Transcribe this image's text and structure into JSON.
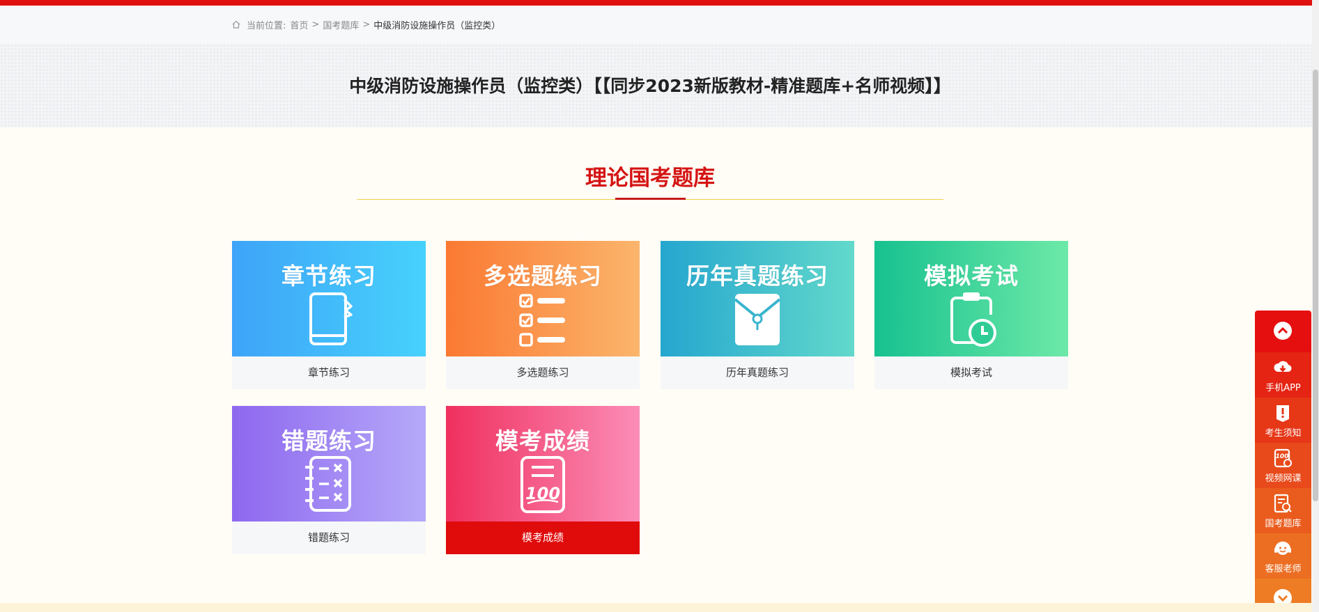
{
  "breadcrumb": {
    "prefix": "当前位置:",
    "items": [
      "首页",
      "国考题库",
      "中级消防设施操作员（监控类）"
    ],
    "separator": ">"
  },
  "page_title": "中级消防设施操作员（监控类）【【同步2023新版教材-精准题库+名师视频】】",
  "section_title": "理论国考题库",
  "cards": [
    {
      "banner": "章节练习",
      "caption": "章节练习",
      "icon": "book-icon"
    },
    {
      "banner": "多选题练习",
      "caption": "多选题练习",
      "icon": "checklist-icon"
    },
    {
      "banner": "历年真题练习",
      "caption": "历年真题练习",
      "icon": "file-pouch-icon"
    },
    {
      "banner": "模拟考试",
      "caption": "模拟考试",
      "icon": "clipboard-clock-icon"
    },
    {
      "banner": "错题练习",
      "caption": "错题练习",
      "icon": "notebook-x-icon"
    },
    {
      "banner": "模考成绩",
      "caption": "模考成绩",
      "icon": "score-100-icon",
      "active": true
    }
  ],
  "sidebar": {
    "items": [
      {
        "label": "手机APP",
        "icon": "cloud-download-icon"
      },
      {
        "label": "考生须知",
        "icon": "notice-icon"
      },
      {
        "label": "视频网课",
        "icon": "video-course-icon"
      },
      {
        "label": "国考题库",
        "icon": "question-bank-icon"
      },
      {
        "label": "客服老师",
        "icon": "headset-icon"
      }
    ],
    "up_icon": "chevron-up-icon",
    "down_icon": "chevron-down-icon"
  },
  "colors": {
    "brand_red": "#e01010",
    "section_title": "#d41313",
    "active_caption": "#e00b0b"
  }
}
